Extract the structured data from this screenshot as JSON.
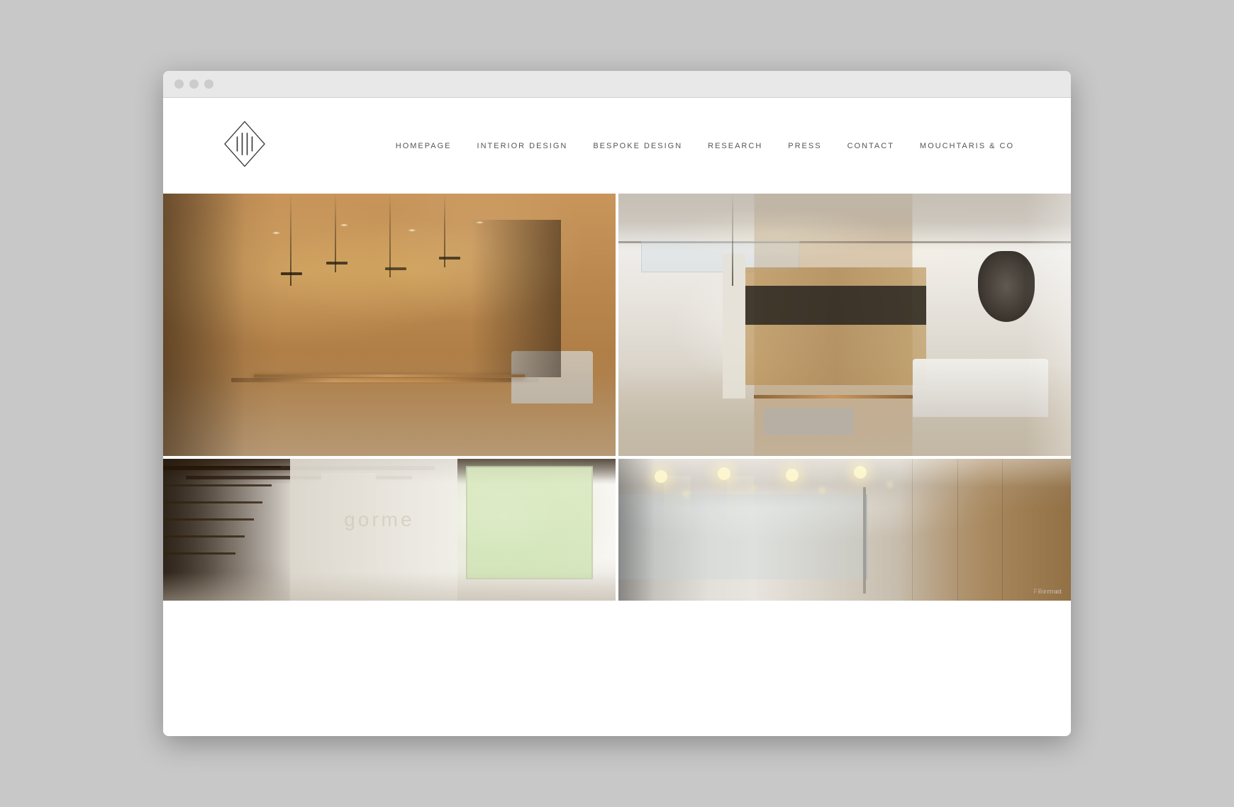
{
  "browser": {
    "dots": [
      "dot1",
      "dot2",
      "dot3"
    ]
  },
  "header": {
    "logo_alt": "111 Design Logo"
  },
  "nav": {
    "items": [
      {
        "id": "homepage",
        "label": "HOMEPAGE"
      },
      {
        "id": "interior-design",
        "label": "INTERIOR DESIGN"
      },
      {
        "id": "bespoke-design",
        "label": "BESPOKE DESIGN"
      },
      {
        "id": "research",
        "label": "RESEARCH"
      },
      {
        "id": "press",
        "label": "PRESS"
      },
      {
        "id": "contact",
        "label": "CONTACT"
      },
      {
        "id": "mouchtaris",
        "label": "MOUCHTARIS & CO"
      }
    ]
  },
  "gallery": {
    "images": [
      {
        "id": "top-left",
        "alt": "Modern interior dining room with pendant lights and wood dining table with white chairs",
        "position": "top-left"
      },
      {
        "id": "top-right",
        "alt": "Modern open-plan kitchen and living area with wood cabinetry and mezzanine level",
        "position": "top-right"
      },
      {
        "id": "bottom-left",
        "alt": "Modern staircase with dark wood treads and bright natural window light",
        "position": "bottom-left"
      },
      {
        "id": "bottom-right",
        "alt": "Modern interior with glass railing, recessed ceiling lights and wood paneling",
        "position": "bottom-right"
      }
    ]
  },
  "watermark": {
    "label": "Format"
  }
}
